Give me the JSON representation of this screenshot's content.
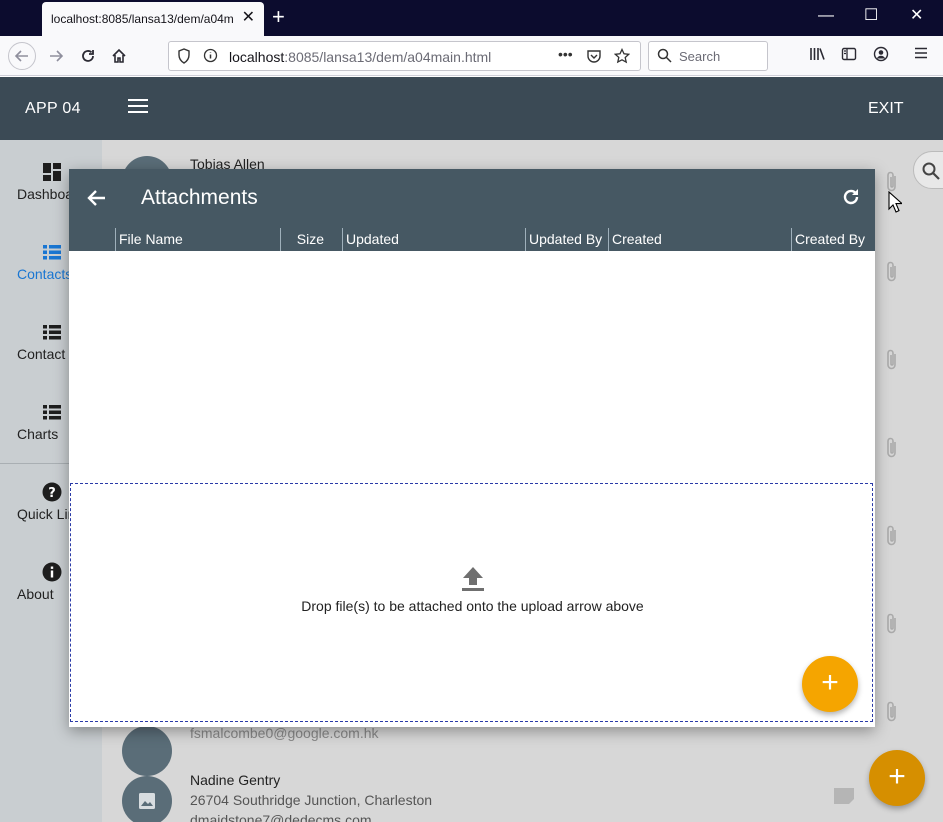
{
  "browser": {
    "tab_title": "localhost:8085/lansa13/dem/a04m",
    "tab_close": "✕",
    "new_tab": "+",
    "win_min": "—",
    "win_max": "☐",
    "win_close": "✕",
    "url_host": "localhost",
    "url_rest": ":8085/lansa13/dem/a04main.html",
    "url_more": "•••",
    "search_placeholder": "Search"
  },
  "app": {
    "title": "APP 04",
    "exit_label": "EXIT"
  },
  "sidebar": {
    "items": [
      {
        "label": "Dashboard",
        "icon": "dashboard-icon"
      },
      {
        "label": "Contacts",
        "icon": "list-icon"
      },
      {
        "label": "Contact",
        "icon": "list-icon"
      },
      {
        "label": "Charts",
        "icon": "list-icon"
      },
      {
        "label": "Quick Links",
        "icon": "help-icon"
      },
      {
        "label": "About",
        "icon": "info-icon"
      }
    ],
    "active_index": 1
  },
  "contacts": [
    {
      "name": "Tobias Allen"
    },
    {
      "line2": "fsmalcombe0@google.com.hk"
    },
    {
      "name": "Nadine Gentry",
      "line1": "26704 Southridge Junction, Charleston",
      "line2": "dmaidstone7@dedecms.com"
    }
  ],
  "dialog": {
    "title": "Attachments",
    "columns": [
      "File Name",
      "Size",
      "Updated",
      "Updated By",
      "Created",
      "Created By"
    ],
    "drop_text": "Drop file(s) to be attached onto the upload arrow above",
    "fab_label": "+"
  },
  "page_fab_label": "+",
  "colors": {
    "header": "#3b4a55",
    "dialog_header": "#465863",
    "accent": "#f5a500",
    "active_nav": "#1976d2"
  }
}
